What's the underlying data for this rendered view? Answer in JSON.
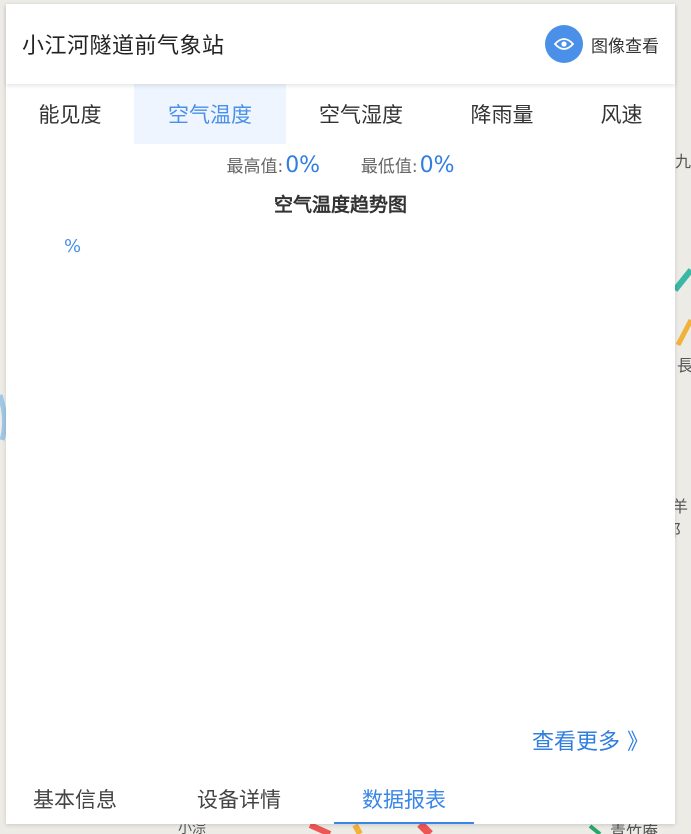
{
  "map": {
    "labels": [
      "九",
      "長",
      "羊阝",
      "小淙",
      "青竹庵"
    ]
  },
  "panel": {
    "title": "小江河隧道前气象站",
    "view_image": {
      "label": "图像查看",
      "icon": "eye-icon",
      "accent": "#4a90e8"
    }
  },
  "tabs": {
    "items": [
      {
        "label": "能见度"
      },
      {
        "label": "空气温度"
      },
      {
        "label": "空气湿度"
      },
      {
        "label": "降雨量"
      },
      {
        "label": "风速"
      }
    ],
    "active": "空气温度"
  },
  "stats": {
    "max_label": "最高值:",
    "max_value": "0%",
    "min_label": "最低值:",
    "min_value": "0%"
  },
  "chart": {
    "title": "空气温度趋势图",
    "y_unit": "%"
  },
  "more_link": "查看更多 》",
  "bottom_tabs": {
    "items": [
      {
        "label": "基本信息"
      },
      {
        "label": "设备详情"
      },
      {
        "label": "数据报表"
      }
    ],
    "active": "数据报表"
  },
  "colors": {
    "accent": "#4a90e8",
    "value_blue": "#2f7ee0",
    "active_tab_bg": "#eef5fe"
  }
}
